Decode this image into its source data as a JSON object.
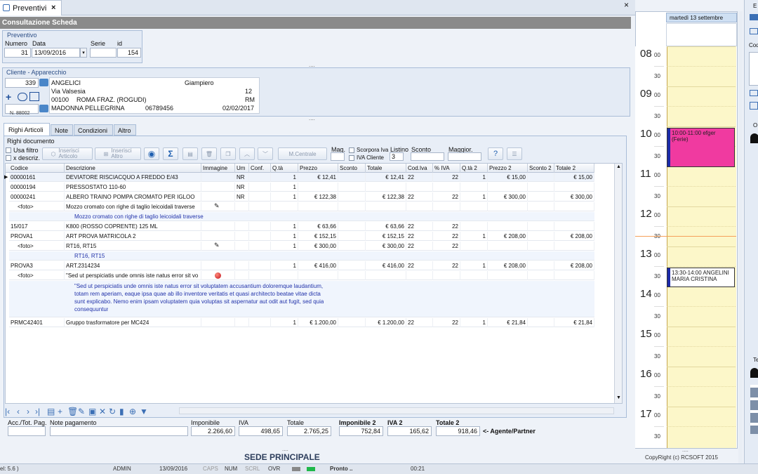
{
  "tab": {
    "label": "Preventivi"
  },
  "title_bar": "Consultazione Scheda",
  "preventivo": {
    "group_title": "Preventivo",
    "numero_label": "Numero",
    "data_label": "Data",
    "serie_label": "Serie",
    "id_label": "id",
    "numero": "31",
    "data": "13/09/2016",
    "serie": "",
    "id": "154"
  },
  "cliente": {
    "group_title": "Cliente - Apparecchio",
    "code": "339",
    "surname": "ANGELICI",
    "name": "Giampiero",
    "street": "Via Valsesia",
    "number": "12",
    "cap": "00100",
    "city": "ROMA FRAZ. (ROGUDI)",
    "prov": "RM",
    "apparecchio": "MADONNA PELLEGRINA",
    "phone": "06789456",
    "date": "02/02/2017",
    "serial_label": "N. 88002"
  },
  "tabs": [
    "Righi Articoli",
    "Note",
    "Condizioni",
    "Altro"
  ],
  "righi": {
    "group_title": "Righi documento",
    "usa_filtro": "Usa filtro",
    "x_descriz": "x descriz.",
    "inserisci_articolo": "Inserisci Articolo",
    "inserisci_altro": "Inserisci Altro",
    "magazzino_btn": "M.Centrale",
    "mag_label": "Mag.",
    "scorpora_iva": "Scorpora Iva",
    "iva_cliente": "IVA Cliente",
    "listino_label": "Listino",
    "listino_value": "3",
    "sconto_label": "Sconto",
    "maggior_label": "Maggior."
  },
  "columns": [
    "Codice",
    "Descrizione",
    "Immagine",
    "Um",
    "Conf.",
    "Q.tà",
    "Prezzo",
    "Sconto",
    "Totale",
    "Cod.Iva",
    "% IVA",
    "Q.tà 2",
    "Prezzo 2",
    "Sconto 2",
    "Totale 2"
  ],
  "rows": [
    {
      "codice": "00000161",
      "desc": "DEVIATORE RISCIACQUO A FREDDO E/43",
      "um": "NR",
      "qta": "1",
      "prezzo": "€ 12,41",
      "totale": "€ 12,41",
      "codiva": "22",
      "piva": "22",
      "qta2": "1",
      "prezzo2": "€ 15,00",
      "totale2": "€ 15,00"
    },
    {
      "codice": "00000194",
      "desc": "PRESSOSTATO 110-60",
      "um": "NR",
      "qta": "1"
    },
    {
      "codice": "00000241",
      "desc": "ALBERO TRAINO POMPA CROMATO PER IGLOO",
      "um": "NR",
      "qta": "1",
      "prezzo": "€ 122,38",
      "totale": "€ 122,38",
      "codiva": "22",
      "piva": "22",
      "qta2": "1",
      "prezzo2": "€ 300,00",
      "totale2": "€ 300,00"
    },
    {
      "codice": "<foto>",
      "desc": "Mozzo cromato con righe di taglio leicoidali traverse",
      "img": "pen"
    },
    {
      "note": "Mozzo cromato con righe di taglio leicoidali traverse"
    },
    {
      "codice": "15/017",
      "desc": "K800 (ROSSO COPRENTE) 125 ML",
      "qta": "1",
      "prezzo": "€ 63,66",
      "totale": "€ 63,66",
      "codiva": "22",
      "piva": "22"
    },
    {
      "codice": "PROVA1",
      "desc": "ART PROVA MATRICOLA 2",
      "qta": "1",
      "prezzo": "€ 152,15",
      "totale": "€ 152,15",
      "codiva": "22",
      "piva": "22",
      "qta2": "1",
      "prezzo2": "€ 208,00",
      "totale2": "€ 208,00"
    },
    {
      "codice": "<foto>",
      "desc": "RT16, RT15",
      "img": "pen",
      "qta": "1",
      "prezzo": "€ 300,00",
      "totale": "€ 300,00",
      "codiva": "22",
      "piva": "22"
    },
    {
      "note": "RT16, RT15"
    },
    {
      "codice": "PROVA3",
      "desc": "ART.2314234",
      "qta": "1",
      "prezzo": "€ 416,00",
      "totale": "€ 416,00",
      "codiva": "22",
      "piva": "22",
      "qta2": "1",
      "prezzo2": "€ 208,00",
      "totale2": "€ 208,00"
    },
    {
      "codice": "<foto>",
      "desc": "\"Sed ut perspiciatis unde omnis iste natus error sit vo",
      "img": "ball"
    },
    {
      "longnote": [
        "\"Sed ut perspiciatis unde omnis iste natus error sit voluptatem accusantium doloremque laudantium,",
        "totam rem aperiam, eaque ipsa quae ab illo inventore veritatis et quasi architecto beatae vitae dicta",
        "sunt explicabo. Nemo enim ipsam voluptatem quia voluptas sit aspernatur aut odit aut fugit, sed quia",
        "consequuntur"
      ]
    },
    {
      "codice": "PRMC42401",
      "desc": "Gruppo trasformatore per MC424",
      "qta": "1",
      "prezzo": "€ 1.200,00",
      "totale": "€ 1.200,00",
      "codiva": "22",
      "piva": "22",
      "qta2": "1",
      "prezzo2": "€ 21,84",
      "totale2": "€ 21,84"
    }
  ],
  "footer": {
    "acc_label": "Acc./Tot. Pag.",
    "note_label": "Note pagamento",
    "imponibile_label": "Imponibile",
    "imponibile": "2.266,60",
    "iva_label": "IVA",
    "iva": "498,65",
    "totale_label": "Totale",
    "totale": "2.765,25",
    "imponibile2_label": "Imponibile 2",
    "imponibile2": "752,84",
    "iva2_label": "IVA 2",
    "iva2": "165,62",
    "totale2_label": "Totale 2",
    "totale2": "918,46",
    "agente": "<- Agente/Partner"
  },
  "sede": "SEDE PRINCIPALE",
  "statusbar": {
    "version": "el: 5.6 )",
    "user": "ADMIN",
    "date": "13/09/2016",
    "caps": "CAPS",
    "num": "NUM",
    "scrl": "SCRL",
    "ovr": "OVR",
    "status": "Pronto ..",
    "time": "00:21"
  },
  "calendar": {
    "day_header": "martedì 13 settembre",
    "hours": [
      "08",
      "09",
      "10",
      "11",
      "12",
      "13",
      "14",
      "15",
      "16",
      "17"
    ],
    "half": "30",
    "mins": "00",
    "events": [
      {
        "text": "10:00-11:00 efger (Ferie)",
        "color": "#f03aa0"
      },
      {
        "text": "13:30-14:00 ANGELINI MARIA CRISTINA",
        "color": "#ffffff"
      }
    ],
    "copyright": "CopyRight (c) RCSOFT 2015"
  },
  "right_panel": {
    "top_label": "E",
    "codice_label": "Codi",
    "group_o": "O",
    "group_te": "Te"
  }
}
